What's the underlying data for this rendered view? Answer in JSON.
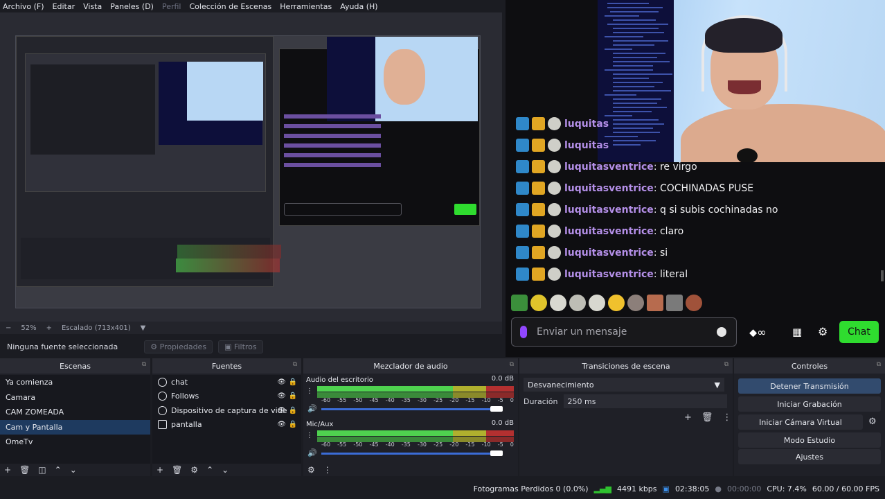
{
  "menu": {
    "items": [
      "Archivo (F)",
      "Editar",
      "Vista",
      "Paneles (D)",
      "Perfil",
      "Colección de Escenas",
      "Herramientas",
      "Ayuda (H)"
    ],
    "disabled_index": 4
  },
  "preview_bar": {
    "zoom_out": "−",
    "zoom": "52%",
    "zoom_in": "+",
    "scale": "Escalado (713x401)"
  },
  "source_bar": {
    "no_source": "Ninguna fuente seleccionada",
    "properties": "Propiedades",
    "filters": "Filtros"
  },
  "chat": {
    "lines": [
      {
        "user": "luquitas",
        "text": ""
      },
      {
        "user": "luquitas",
        "text": ""
      },
      {
        "user": "luquitasventrice",
        "text": ": re virgo"
      },
      {
        "user": "luquitasventrice",
        "text": ": COCHINADAS PUSE"
      },
      {
        "user": "luquitasventrice",
        "text": ": q si subis cochinadas no"
      },
      {
        "user": "luquitasventrice",
        "text": ": claro"
      },
      {
        "user": "luquitasventrice",
        "text": ": si"
      },
      {
        "user": "luquitasventrice",
        "text": ": literal"
      }
    ],
    "input_placeholder": "Enviar un mensaje",
    "send_button": "Chat",
    "colors": {
      "username": "#b48fe8",
      "send": "#2fdc2f"
    }
  },
  "docks": {
    "scenes": {
      "title": "Escenas",
      "items": [
        "Ya comienza",
        "Camara",
        "CAM ZOMEADA",
        "Cam y Pantalla",
        "OmeTv"
      ],
      "selected_index": 3
    },
    "sources": {
      "title": "Fuentes",
      "items": [
        {
          "label": "chat",
          "icon": "globe-icon"
        },
        {
          "label": "Follows",
          "icon": "globe-icon"
        },
        {
          "label": "Dispositivo de captura de vide",
          "icon": "camera-icon"
        },
        {
          "label": "pantalla",
          "icon": "monitor-icon"
        }
      ]
    },
    "mixer": {
      "title": "Mezclador de audio",
      "channels": [
        {
          "name": "Audio del escritorio",
          "db": "0.0 dB",
          "level": 0.98
        },
        {
          "name": "Mic/Aux",
          "db": "0.0 dB",
          "level": 0.98
        }
      ],
      "scale": [
        "-60",
        "-55",
        "-50",
        "-45",
        "-40",
        "-35",
        "-30",
        "-25",
        "-20",
        "-15",
        "-10",
        "-5",
        "0"
      ]
    },
    "transitions": {
      "title": "Transiciones de escena",
      "selected": "Desvanecimiento",
      "duration_label": "Duración",
      "duration_value": "250 ms"
    },
    "controls": {
      "title": "Controles",
      "buttons": [
        "Detener Transmisión",
        "Iniciar Grabación",
        "Iniciar Cámara Virtual",
        "Modo Estudio",
        "Ajustes"
      ]
    }
  },
  "status": {
    "dropped": "Fotogramas Perdidos 0 (0.0%)",
    "bitrate": "4491 kbps",
    "live_time": "02:38:05",
    "rec_time": "00:00:00",
    "cpu": "CPU: 7.4%",
    "fps": "60.00 / 60.00 FPS"
  }
}
